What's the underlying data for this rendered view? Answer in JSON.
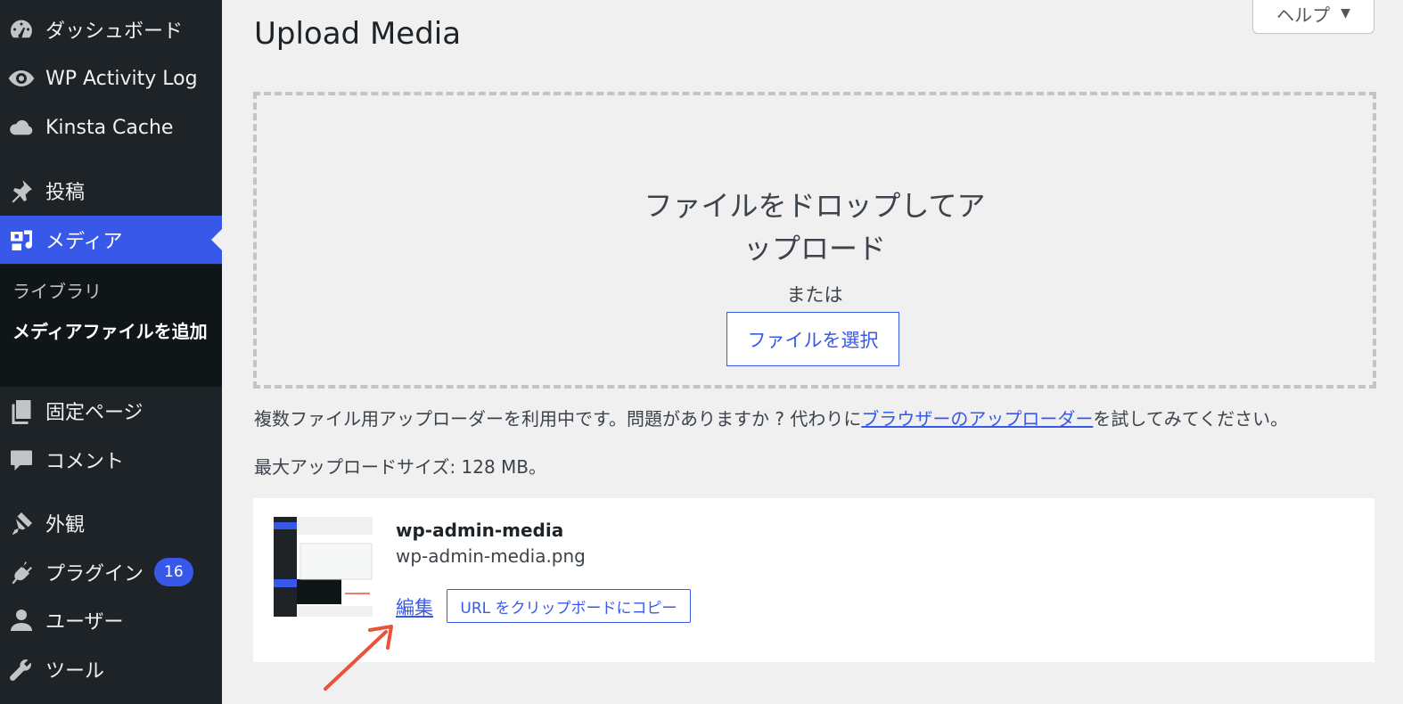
{
  "sidebar": {
    "items": [
      {
        "label": "ダッシュボード",
        "icon": "dashboard-icon"
      },
      {
        "label": "WP Activity Log",
        "icon": "eye-icon"
      },
      {
        "label": "Kinsta Cache",
        "icon": "cloud-icon"
      },
      {
        "label": "投稿",
        "icon": "pushpin-icon"
      },
      {
        "label": "メディア",
        "icon": "media-icon"
      },
      {
        "label": "固定ページ",
        "icon": "pages-icon"
      },
      {
        "label": "コメント",
        "icon": "comment-icon"
      },
      {
        "label": "外観",
        "icon": "paintbrush-icon"
      },
      {
        "label": "プラグイン",
        "icon": "plugin-icon",
        "badge": "16"
      },
      {
        "label": "ユーザー",
        "icon": "user-icon"
      },
      {
        "label": "ツール",
        "icon": "wrench-icon"
      }
    ],
    "submenu": [
      {
        "label": "ライブラリ"
      },
      {
        "label": "メディアファイルを追加"
      }
    ]
  },
  "help": {
    "label": "ヘルプ"
  },
  "page": {
    "title": "Upload Media"
  },
  "drop": {
    "instructions": "ファイルをドロップしてアップロード",
    "or": "または",
    "select_button": "ファイルを選択"
  },
  "note": {
    "prefix": "複数ファイル用アップローダーを利用中です。問題がありますか ? 代わりに",
    "link": "ブラウザーのアップローダー",
    "suffix": "を試してみてください。"
  },
  "max_size": "最大アップロードサイズ: 128 MB。",
  "media_item": {
    "title": "wp-admin-media",
    "filename": "wp-admin-media.png",
    "edit_link": "編集",
    "copy_button": "URL をクリップボードにコピー"
  },
  "colors": {
    "accent": "#3858e9",
    "sidebar_bg": "#1d2327",
    "arrow": "#e8533a"
  }
}
